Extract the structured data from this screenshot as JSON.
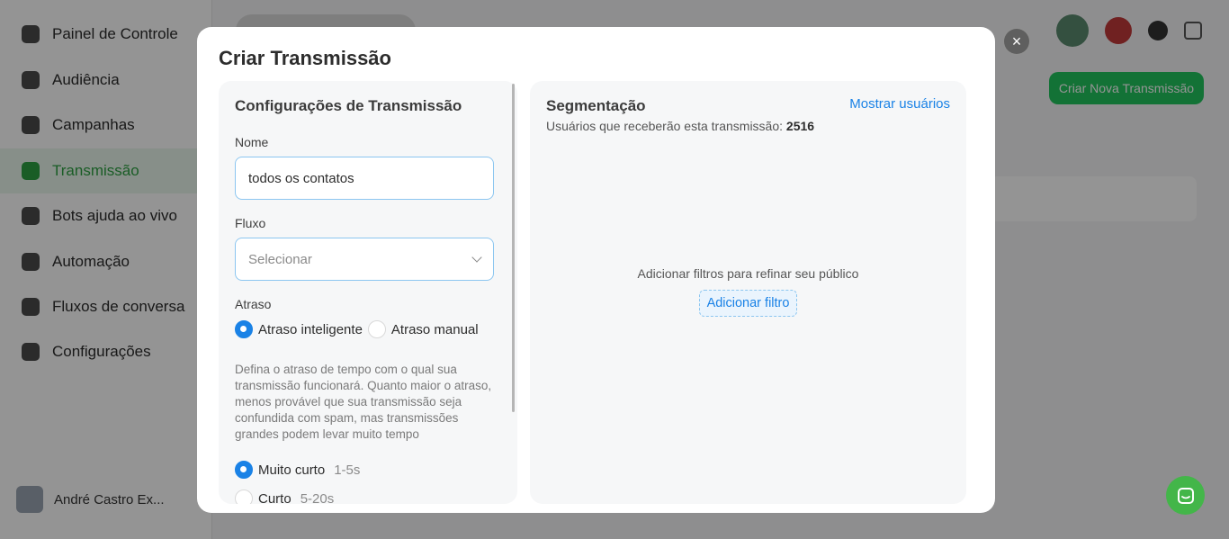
{
  "background": {
    "sidebar_items": [
      {
        "label": "Painel de Controle"
      },
      {
        "label": "Audiência"
      },
      {
        "label": "Campanhas"
      },
      {
        "label": "Transmissão"
      },
      {
        "label": "Bots ajuda ao vivo"
      },
      {
        "label": "Automação"
      },
      {
        "label": "Fluxos de conversa"
      },
      {
        "label": "Configurações"
      }
    ],
    "new_button": "Criar Nova Transmissão",
    "user_name": "André Castro Ex..."
  },
  "modal": {
    "title": "Criar Transmissão",
    "close_icon": "×",
    "left": {
      "title": "Configurações de Transmissão",
      "name_label": "Nome",
      "name_value": "todos os contatos",
      "flow_label": "Fluxo",
      "flow_placeholder": "Selecionar",
      "delay_label": "Atraso",
      "delay_options": [
        {
          "label": "Atraso inteligente",
          "checked": true
        },
        {
          "label": "Atraso manual",
          "checked": false
        }
      ],
      "description": "Defina o atraso de tempo com o qual sua transmissão funcionará. Quanto maior o atraso, menos provável que sua transmissão seja confundida com spam, mas transmissões grandes podem levar muito tempo",
      "speed_options": [
        {
          "label": "Muito curto",
          "range": "1-5s",
          "checked": true
        },
        {
          "label": "Curto",
          "range": "5-20s",
          "checked": false
        }
      ]
    },
    "right": {
      "title": "Segmentação",
      "subtitle_prefix": "Usuários que receberão esta transmissão:",
      "subtitle_count": "2516",
      "show_users": "Mostrar usuários",
      "empty_text": "Adicionar filtros para refinar seu público",
      "add_filter": "Adicionar filtro"
    }
  },
  "colors": {
    "accent": "#1a82e6",
    "green": "#43b649"
  }
}
